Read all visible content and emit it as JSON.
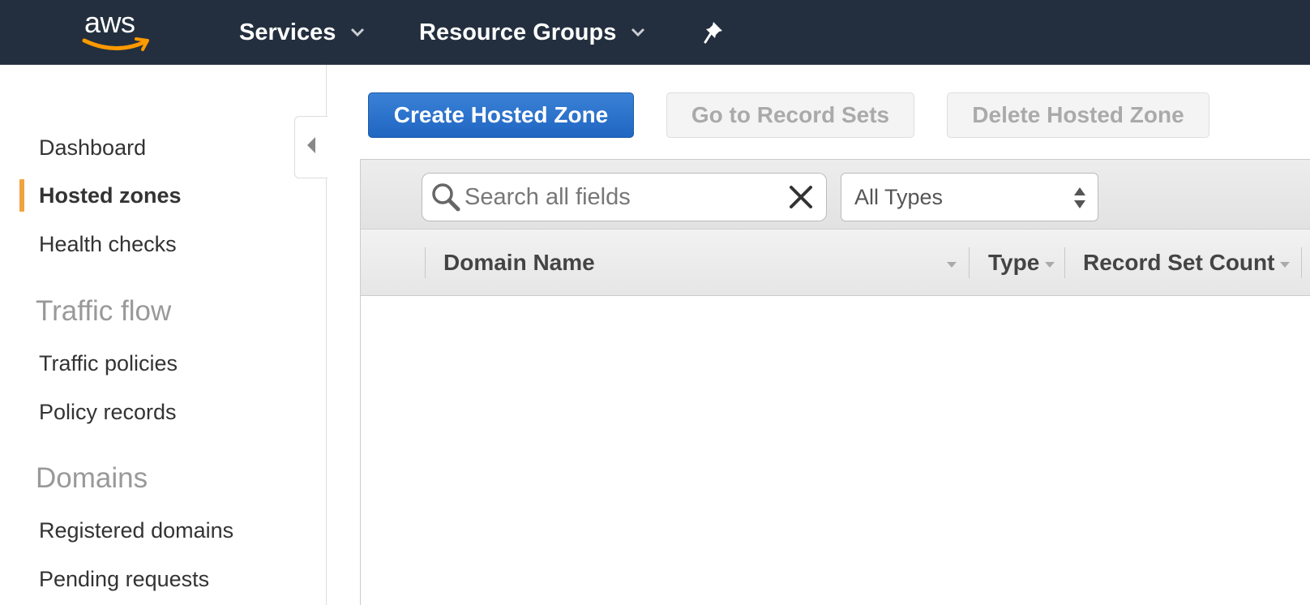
{
  "topnav": {
    "logo_text": "aws",
    "services_label": "Services",
    "resource_groups_label": "Resource Groups"
  },
  "sidebar": {
    "items": [
      {
        "label": "Dashboard"
      },
      {
        "label": "Hosted zones",
        "active": true
      },
      {
        "label": "Health checks"
      }
    ],
    "traffic_flow_heading": "Traffic flow",
    "traffic_flow_items": [
      {
        "label": "Traffic policies"
      },
      {
        "label": "Policy records"
      }
    ],
    "domains_heading": "Domains",
    "domains_items": [
      {
        "label": "Registered domains"
      },
      {
        "label": "Pending requests"
      }
    ]
  },
  "toolbar": {
    "create_label": "Create Hosted Zone",
    "goto_label": "Go to Record Sets",
    "delete_label": "Delete Hosted Zone"
  },
  "filter": {
    "search_placeholder": "Search all fields",
    "search_value": "",
    "type_selected": "All Types"
  },
  "table": {
    "columns": [
      {
        "label": "Domain Name"
      },
      {
        "label": "Type"
      },
      {
        "label": "Record Set Count"
      }
    ],
    "rows": []
  },
  "colors": {
    "nav_bg": "#232f3e",
    "primary_button": "#2a72cc",
    "active_indicator": "#f0a33e",
    "logo_smile": "#ff9900"
  }
}
